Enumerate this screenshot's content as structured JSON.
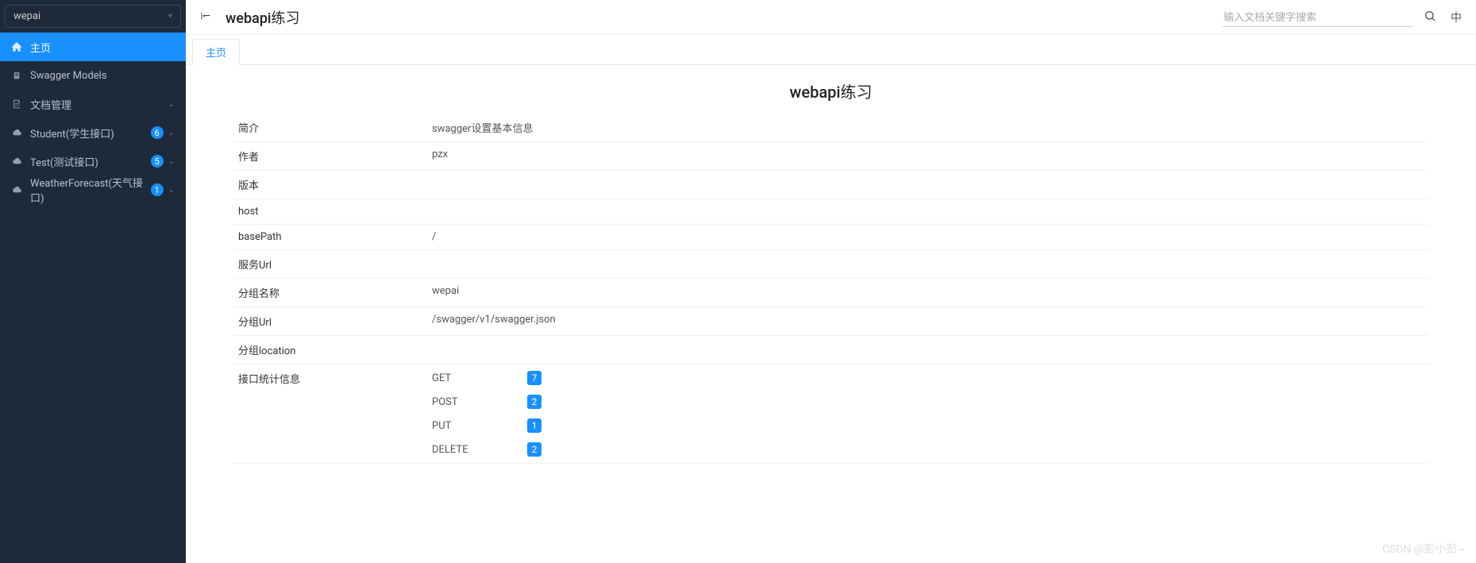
{
  "sidebar": {
    "select_value": "wepai",
    "items": [
      {
        "icon": "home",
        "label": "主页",
        "badge": null,
        "expandable": false,
        "active": true
      },
      {
        "icon": "models",
        "label": "Swagger Models",
        "badge": null,
        "expandable": false,
        "active": false
      },
      {
        "icon": "doc",
        "label": "文档管理",
        "badge": null,
        "expandable": true,
        "active": false
      },
      {
        "icon": "cloud",
        "label": "Student(学生接口)",
        "badge": "6",
        "expandable": true,
        "active": false
      },
      {
        "icon": "cloud",
        "label": "Test(测试接口)",
        "badge": "5",
        "expandable": true,
        "active": false
      },
      {
        "icon": "cloud",
        "label": "WeatherForecast(天气接口)",
        "badge": "1",
        "expandable": true,
        "active": false
      }
    ]
  },
  "header": {
    "title": "webapi练习",
    "search_placeholder": "输入文档关键字搜索",
    "lang": "中"
  },
  "tabs": [
    {
      "label": "主页",
      "active": true
    }
  ],
  "page": {
    "title": "webapi练习",
    "rows": [
      {
        "label": "简介",
        "value": "swagger设置基本信息"
      },
      {
        "label": "作者",
        "value": "pzx"
      },
      {
        "label": "版本",
        "value": ""
      },
      {
        "label": "host",
        "value": ""
      },
      {
        "label": "basePath",
        "value": "/"
      },
      {
        "label": "服务Url",
        "value": ""
      },
      {
        "label": "分组名称",
        "value": "wepai"
      },
      {
        "label": "分组Url",
        "value": "/swagger/v1/swagger.json"
      },
      {
        "label": "分组location",
        "value": ""
      }
    ],
    "stats_label": "接口统计信息",
    "stats": [
      {
        "method": "GET",
        "count": "7"
      },
      {
        "method": "POST",
        "count": "2"
      },
      {
        "method": "PUT",
        "count": "1"
      },
      {
        "method": "DELETE",
        "count": "2"
      }
    ]
  },
  "watermark": "CSDN @彭小彭~"
}
